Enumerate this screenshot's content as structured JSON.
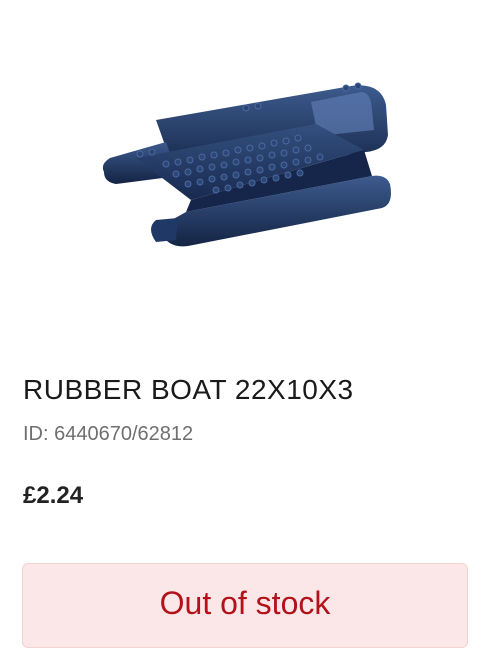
{
  "product": {
    "image_icon": "rubber-boat-icon",
    "title": "RUBBER BOAT 22X10X3",
    "id_text": "ID: 6440670/62812",
    "price": "£2.24",
    "stock_button_label": "Out of stock"
  },
  "colors": {
    "boat": "#1f3563",
    "stock_button_bg": "#fbe7e7",
    "stock_button_text": "#b3121b"
  }
}
